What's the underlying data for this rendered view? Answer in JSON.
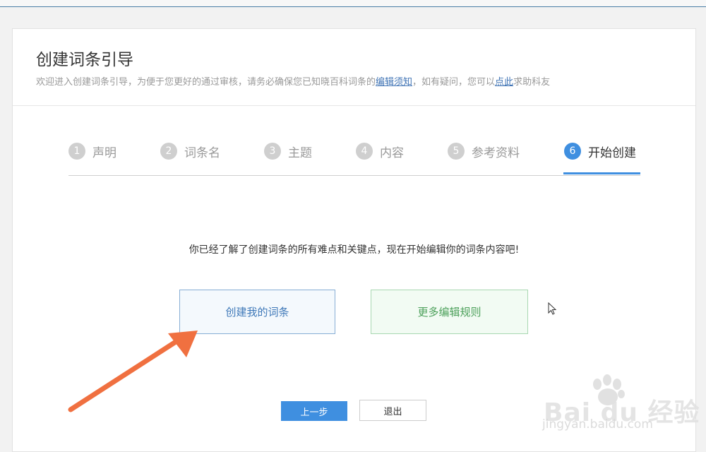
{
  "header": {
    "title": "创建词条引导",
    "subtitle_prefix": "欢迎进入创建词条引导，为便于您更好的通过审核，请务必确保您已知晓百科词条的",
    "edit_notice_link": "编辑须知",
    "subtitle_middle": "，如有疑问，您可以",
    "click_here_link": "点此",
    "subtitle_suffix": "求助科友"
  },
  "steps": [
    {
      "num": "1",
      "label": "声明"
    },
    {
      "num": "2",
      "label": "词条名"
    },
    {
      "num": "3",
      "label": "主题"
    },
    {
      "num": "4",
      "label": "内容"
    },
    {
      "num": "5",
      "label": "参考资料"
    },
    {
      "num": "6",
      "label": "开始创建",
      "active": true
    }
  ],
  "main": {
    "message": "你已经了解了创建词条的所有难点和关键点，现在开始编辑你的词条内容吧!",
    "create_button": "创建我的词条",
    "rules_button": "更多编辑规则",
    "prev_button": "上一步",
    "exit_button": "退出"
  },
  "watermark": {
    "brand": "Bai du 经验",
    "url": "jingyan.baidu.com"
  },
  "icons": {
    "arrow": "arrow-annotation-icon",
    "cursor": "mouse-cursor-icon",
    "paw": "baidu-paw-icon"
  },
  "colors": {
    "accent": "#3f8fe0",
    "annotation": "#f07040",
    "create_border": "#86add4",
    "rules_border": "#a8d7b1"
  }
}
